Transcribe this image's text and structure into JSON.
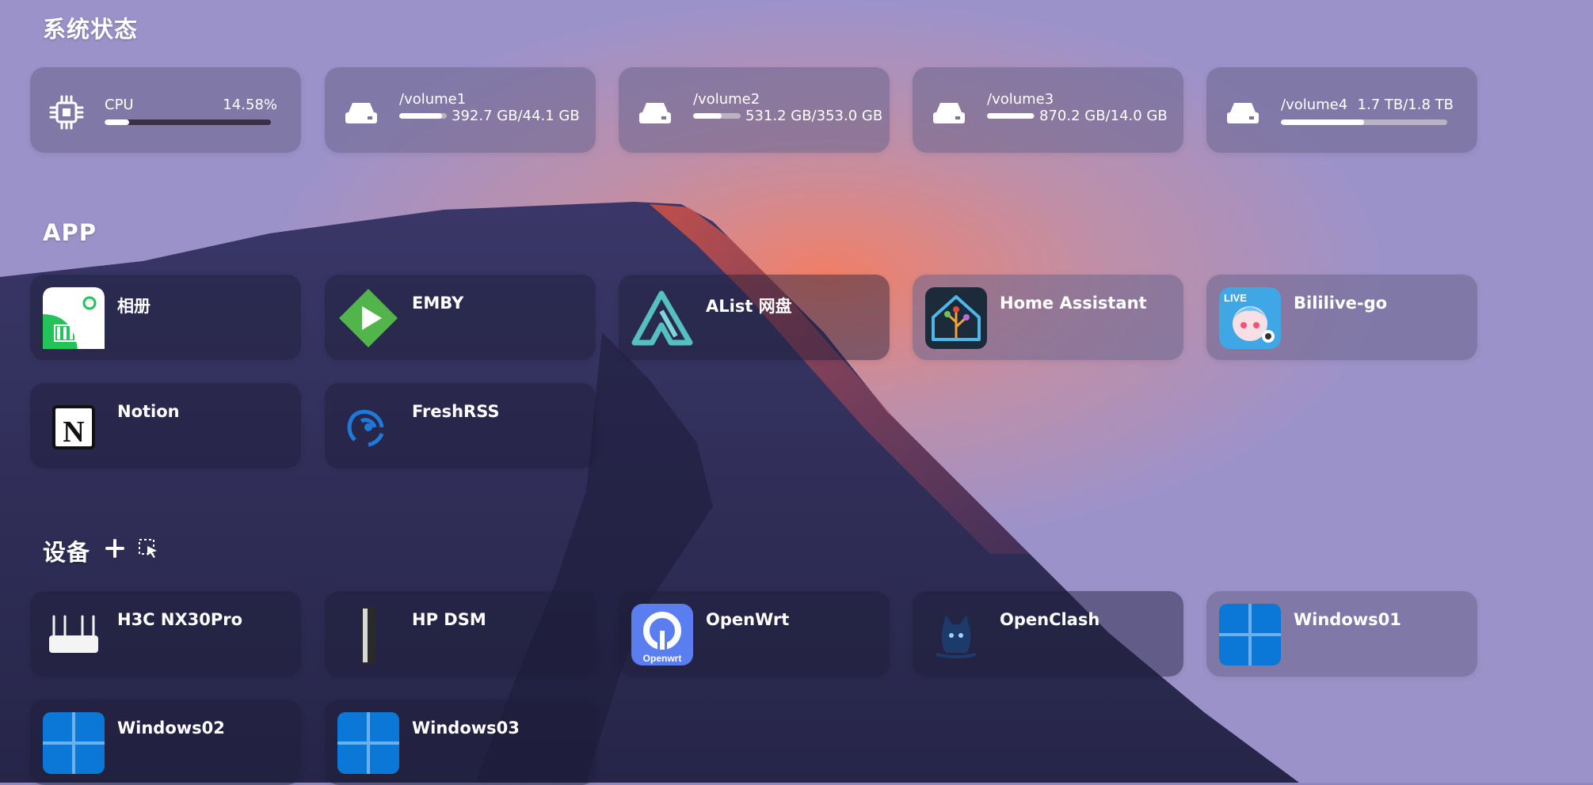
{
  "sections": {
    "system": "系统状态",
    "app": "APP",
    "devices": "设备"
  },
  "system_status": {
    "cpu": {
      "name": "CPU",
      "value": "14.58%",
      "usage_fraction": 0.1458
    },
    "volumes": [
      {
        "name": "/volume1",
        "value": "392.7 GB/44.1 GB",
        "usage_fraction": 0.9
      },
      {
        "name": "/volume2",
        "value": "531.2 GB/353.0 GB",
        "usage_fraction": 0.6
      },
      {
        "name": "/volume3",
        "value": "870.2 GB/14.0 GB",
        "usage_fraction": 0.98
      },
      {
        "name": "/volume4",
        "value": "1.7 TB/1.8 TB",
        "usage_fraction": 0.5
      }
    ]
  },
  "apps": [
    {
      "label": "相册",
      "icon": "photo-album-icon"
    },
    {
      "label": "EMBY",
      "icon": "emby-icon"
    },
    {
      "label": "AList 网盘",
      "icon": "alist-icon"
    },
    {
      "label": "Home Assistant",
      "icon": "home-assistant-icon"
    },
    {
      "label": "Bililive-go",
      "icon": "bililive-icon",
      "icon_text": "LIVE"
    },
    {
      "label": "Notion",
      "icon": "notion-icon",
      "icon_text": "N"
    },
    {
      "label": "FreshRSS",
      "icon": "freshrss-icon"
    }
  ],
  "devices": [
    {
      "label": "H3C NX30Pro",
      "icon": "router-icon"
    },
    {
      "label": "HP DSM",
      "icon": "server-tower-icon"
    },
    {
      "label": "OpenWrt",
      "icon": "openwrt-icon",
      "icon_text": "Openwrt"
    },
    {
      "label": "OpenClash",
      "icon": "openclash-cat-icon"
    },
    {
      "label": "Windows01",
      "icon": "windows-icon"
    },
    {
      "label": "Windows02",
      "icon": "windows-icon"
    },
    {
      "label": "Windows03",
      "icon": "windows-icon"
    }
  ],
  "colors": {
    "sky": "#9a90c8",
    "mountain": "#2b2a52",
    "glow": "#ff6b4a",
    "windows_blue": "#0b78d7",
    "emby_green": "#52b54b",
    "alist_teal": "#56c0c0",
    "openwrt_blue": "#5a7ef0"
  }
}
